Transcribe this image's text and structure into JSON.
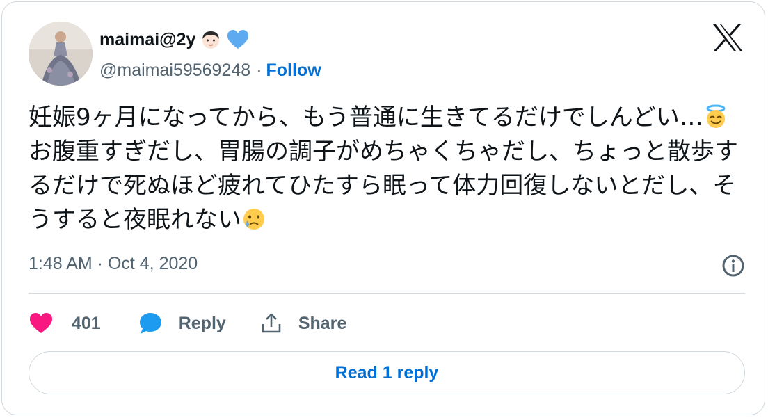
{
  "author": {
    "display_name": "maimai@2y",
    "handle": "@maimai59569248",
    "separator": "·",
    "follow_label": "Follow",
    "name_emojis": [
      "boy-emoji",
      "blue-heart-emoji"
    ]
  },
  "tweet": {
    "segments": [
      "妊娠9ヶ月になってから、もう普通に生きてるだけでしんどい…",
      "お腹重すぎだし、胃腸の調子がめちゃくちゃだし、ちょっと散歩するだけで死ぬほど疲れてひたすら眠って体力回復しないとだし、そうすると夜眠れない"
    ],
    "emojis": [
      "smiling-face-with-halo-emoji",
      "crying-face-emoji"
    ],
    "timestamp": "1:48 AM · Oct 4, 2020"
  },
  "actions": {
    "like_count": "401",
    "reply_label": "Reply",
    "share_label": "Share"
  },
  "read_replies_label": "Read 1 reply",
  "colors": {
    "link": "#006fd6",
    "like": "#f91880",
    "reply": "#1d9bf0",
    "text": "#0f1419",
    "muted": "#536471",
    "border": "#cfd9de"
  }
}
